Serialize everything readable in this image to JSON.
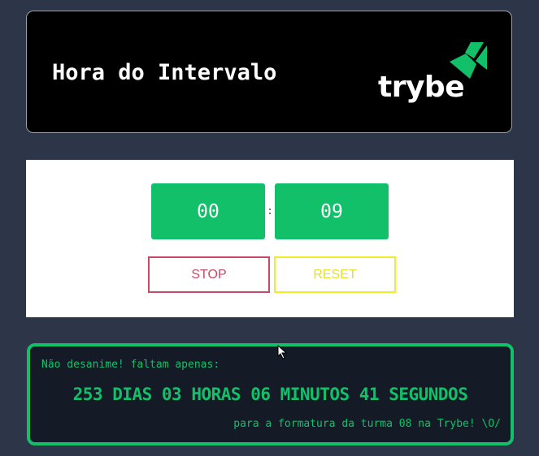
{
  "header": {
    "title": "Hora do Intervalo",
    "logo_text": "trybe",
    "logo_icon": "trybe-arrow-icon",
    "background_color": "#000000",
    "logo_color": "#12c06a"
  },
  "timer": {
    "minutes": "00",
    "separator": ":",
    "seconds": "09",
    "box_color": "#12c06a",
    "stop_label": "STOP",
    "stop_color": "#c44a66",
    "reset_label": "RESET",
    "reset_color": "#eded2a"
  },
  "countdown": {
    "intro": "Não desanime! faltam apenas:",
    "text": "253 DIAS 03 HORAS 06 MINUTOS 41 SEGUNDOS",
    "outro": "para a formatura da turma 08 na Trybe! \\O/",
    "accent_color": "#12c06a"
  },
  "colors": {
    "page_background": "#2c3648"
  }
}
